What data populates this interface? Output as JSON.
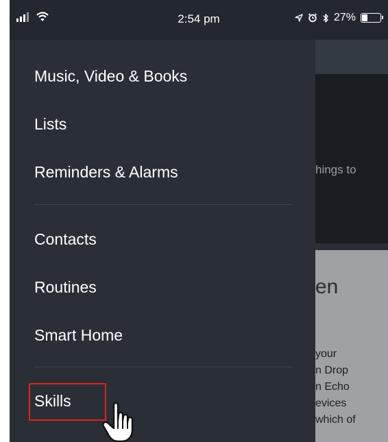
{
  "status_bar": {
    "time": "2:54 pm",
    "battery_text": "27%",
    "battery_level": 0.27,
    "icons": [
      "signal-icon",
      "wifi-icon",
      "location-icon",
      "alarm-icon",
      "bluetooth-icon",
      "battery-icon"
    ]
  },
  "drawer": {
    "groups": [
      [
        "Music, Video & Books",
        "Lists",
        "Reminders & Alarms"
      ],
      [
        "Contacts",
        "Routines",
        "Smart Home"
      ],
      [
        "Skills"
      ]
    ],
    "highlighted_item": "Skills",
    "highlight_color": "#e2231a"
  },
  "background_page": {
    "dark_section_text": "hings to",
    "heading_fragment": "en",
    "body_lines": [
      "your",
      "n Drop",
      "n Echo",
      "evices",
      "which of"
    ]
  },
  "colors": {
    "drawer_bg": "#2a2e36",
    "status_bar_bg": "#23272f",
    "text": "#ffffff"
  }
}
